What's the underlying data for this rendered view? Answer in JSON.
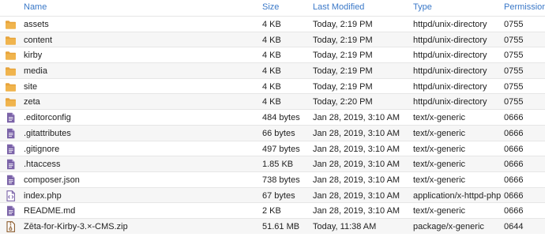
{
  "header": {
    "name": "Name",
    "size": "Size",
    "modified": "Last Modified",
    "type": "Type",
    "permissions": "Permissions"
  },
  "colors": {
    "header_text": "#3a78c8",
    "folder": "#e7a43c",
    "file": "#7b63a8",
    "archive": "#8a5a2b"
  },
  "files": [
    {
      "name": "assets",
      "size": "4 KB",
      "modified": "Today, 2:19 PM",
      "type": "httpd/unix-directory",
      "perm": "0755",
      "icon": "folder-icon"
    },
    {
      "name": "content",
      "size": "4 KB",
      "modified": "Today, 2:19 PM",
      "type": "httpd/unix-directory",
      "perm": "0755",
      "icon": "folder-icon"
    },
    {
      "name": "kirby",
      "size": "4 KB",
      "modified": "Today, 2:19 PM",
      "type": "httpd/unix-directory",
      "perm": "0755",
      "icon": "folder-icon"
    },
    {
      "name": "media",
      "size": "4 KB",
      "modified": "Today, 2:19 PM",
      "type": "httpd/unix-directory",
      "perm": "0755",
      "icon": "folder-icon"
    },
    {
      "name": "site",
      "size": "4 KB",
      "modified": "Today, 2:19 PM",
      "type": "httpd/unix-directory",
      "perm": "0755",
      "icon": "folder-icon"
    },
    {
      "name": "zeta",
      "size": "4 KB",
      "modified": "Today, 2:20 PM",
      "type": "httpd/unix-directory",
      "perm": "0755",
      "icon": "folder-icon"
    },
    {
      "name": ".editorconfig",
      "size": "484 bytes",
      "modified": "Jan 28, 2019, 3:10 AM",
      "type": "text/x-generic",
      "perm": "0666",
      "icon": "text-file-icon"
    },
    {
      "name": ".gitattributes",
      "size": "66 bytes",
      "modified": "Jan 28, 2019, 3:10 AM",
      "type": "text/x-generic",
      "perm": "0666",
      "icon": "text-file-icon"
    },
    {
      "name": ".gitignore",
      "size": "497 bytes",
      "modified": "Jan 28, 2019, 3:10 AM",
      "type": "text/x-generic",
      "perm": "0666",
      "icon": "text-file-icon"
    },
    {
      "name": ".htaccess",
      "size": "1.85 KB",
      "modified": "Jan 28, 2019, 3:10 AM",
      "type": "text/x-generic",
      "perm": "0666",
      "icon": "text-file-icon"
    },
    {
      "name": "composer.json",
      "size": "738 bytes",
      "modified": "Jan 28, 2019, 3:10 AM",
      "type": "text/x-generic",
      "perm": "0666",
      "icon": "text-file-icon"
    },
    {
      "name": "index.php",
      "size": "67 bytes",
      "modified": "Jan 28, 2019, 3:10 AM",
      "type": "application/x-httpd-php",
      "perm": "0666",
      "icon": "code-file-icon"
    },
    {
      "name": "README.md",
      "size": "2 KB",
      "modified": "Jan 28, 2019, 3:10 AM",
      "type": "text/x-generic",
      "perm": "0666",
      "icon": "text-file-icon"
    },
    {
      "name": "Zēta-for-Kirby-3.×-CMS.zip",
      "size": "51.61 MB",
      "modified": "Today, 11:38 AM",
      "type": "package/x-generic",
      "perm": "0644",
      "icon": "archive-file-icon"
    }
  ]
}
